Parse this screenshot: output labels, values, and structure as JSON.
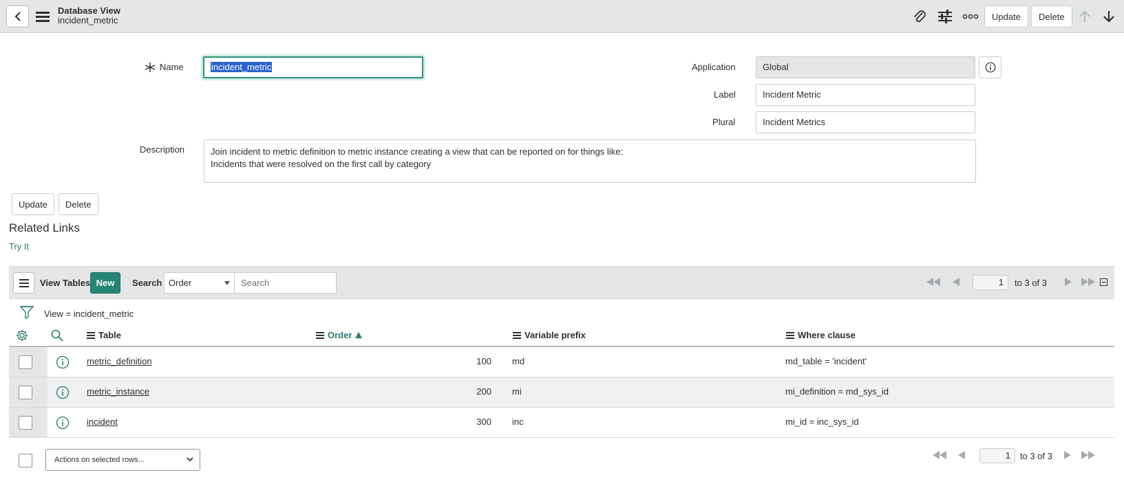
{
  "header": {
    "title": "Database View",
    "subtitle": "incident_metric",
    "update_label": "Update",
    "delete_label": "Delete"
  },
  "form": {
    "name_label": "Name",
    "name_value": "incident_metric",
    "application_label": "Application",
    "application_value": "Global",
    "label_label": "Label",
    "label_value": "Incident Metric",
    "plural_label": "Plural",
    "plural_value": "Incident Metrics",
    "description_label": "Description",
    "description_line1": "Join incident to metric definition to metric instance creating a view that can be reported on for things like:",
    "description_line2": "Incidents that were resolved on the first call by category",
    "update_label": "Update",
    "delete_label": "Delete"
  },
  "related_links": {
    "title": "Related Links",
    "try_it": "Try It"
  },
  "list": {
    "title": "View Tables",
    "new_label": "New",
    "search_label": "Search",
    "search_field": "Order",
    "search_placeholder": "Search",
    "page_number": "1",
    "page_range": "to 3 of 3",
    "breadcrumb": "View = incident_metric",
    "columns": {
      "table": "Table",
      "order": "Order",
      "variable_prefix": "Variable prefix",
      "where_clause": "Where clause"
    },
    "rows": [
      {
        "table": "metric_definition",
        "order": "100",
        "prefix": "md",
        "where": "md_table = 'incident'"
      },
      {
        "table": "metric_instance",
        "order": "200",
        "prefix": "mi",
        "where": "mi_definition = md_sys_id"
      },
      {
        "table": "incident",
        "order": "300",
        "prefix": "inc",
        "where": "mi_id = inc_sys_id"
      }
    ],
    "actions_label": "Actions on selected rows...",
    "footer_page_number": "1",
    "footer_page_range": "to 3 of 3"
  },
  "colors": {
    "accent": "#278575",
    "header_bg": "#e4e6e7",
    "link": "#2a7c6e",
    "selection": "#2a62c9"
  },
  "icons": [
    "back-arrow-icon",
    "menu-icon",
    "paperclip-icon",
    "sliders-icon",
    "more-icon",
    "arrow-up-icon",
    "arrow-down-icon",
    "info-icon",
    "filter-icon",
    "gear-icon",
    "search-icon",
    "first-page-icon",
    "prev-page-icon",
    "next-page-icon",
    "last-page-icon",
    "collapse-icon"
  ]
}
